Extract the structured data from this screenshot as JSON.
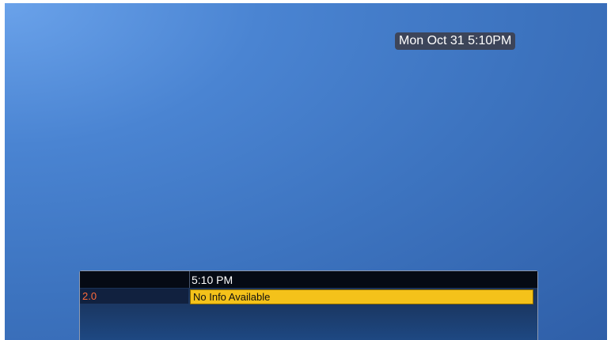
{
  "clock": {
    "datetime": "Mon Oct 31 5:10PM"
  },
  "guide": {
    "time_slot": "5:10 PM",
    "rows": [
      {
        "channel": "2.0",
        "program": "No Info Available"
      }
    ]
  },
  "colors": {
    "background": "#3d74c0",
    "channel_text": "#ff6a3a",
    "selected_program": "#f4c21a"
  }
}
